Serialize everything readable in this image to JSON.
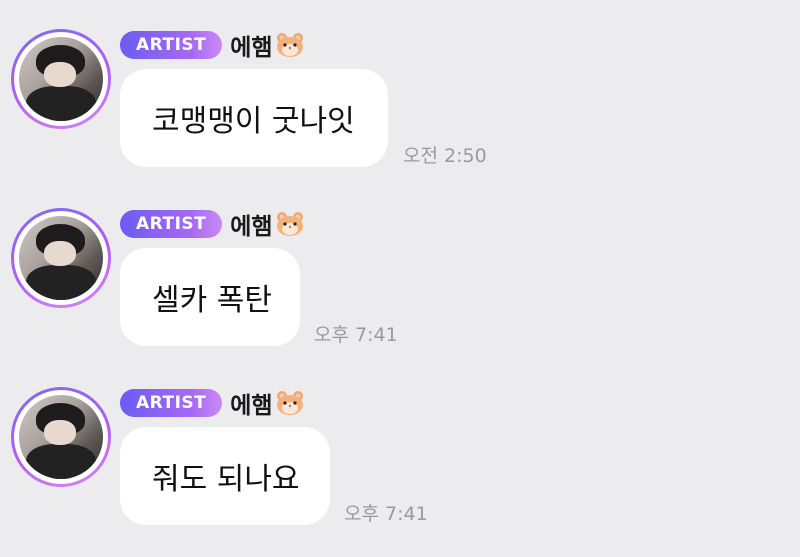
{
  "messages": [
    {
      "badge": "ARTIST",
      "name": "에햄",
      "text": "코맹맹이 굿나잇",
      "time": "오전 2:50"
    },
    {
      "badge": "ARTIST",
      "name": "에햄",
      "text": "셀카 폭탄",
      "time": "오후 7:41"
    },
    {
      "badge": "ARTIST",
      "name": "에햄",
      "text": "줘도 되나요",
      "time": "오후 7:41"
    }
  ],
  "colors": {
    "background": "#ececee",
    "badge_start": "#6b5cf2",
    "badge_end": "#c98af6",
    "bubble": "#ffffff",
    "time": "#9a9a9a"
  },
  "icons": {
    "name_emoji": "hamster-icon"
  }
}
